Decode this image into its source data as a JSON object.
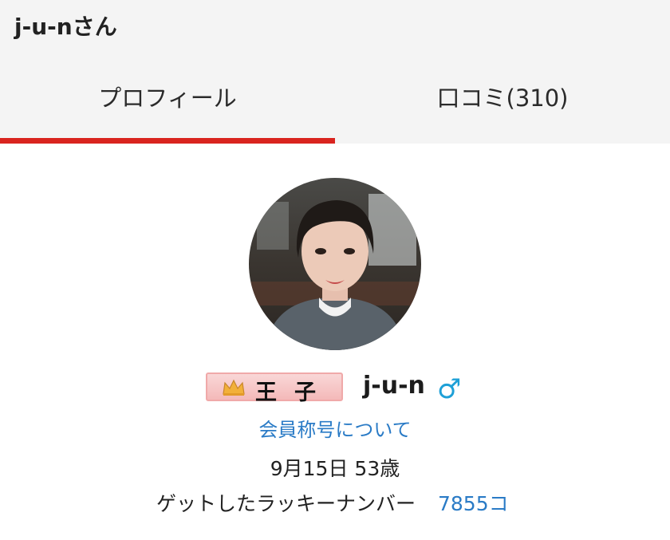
{
  "header": {
    "title": "j-u-nさん",
    "tabs": [
      {
        "label": "プロフィール",
        "active": true
      },
      {
        "label": "口コミ(310)",
        "active": false
      }
    ]
  },
  "profile": {
    "title_badge": "王子",
    "crown_icon": "crown-icon",
    "nickname": "j-u-n",
    "gender_symbol": "♂",
    "rank_link": "会員称号について",
    "birthday_age": "9月15日 53歳",
    "lucky_label": "ゲットしたラッキーナンバー",
    "lucky_count": "7855コ"
  },
  "colors": {
    "header_bg": "#f4f4f4",
    "active_tab_underline": "#d9241f",
    "link": "#2a7bc6",
    "gender": "#1ea0d7",
    "badge_bg": "#f4b9b9"
  }
}
